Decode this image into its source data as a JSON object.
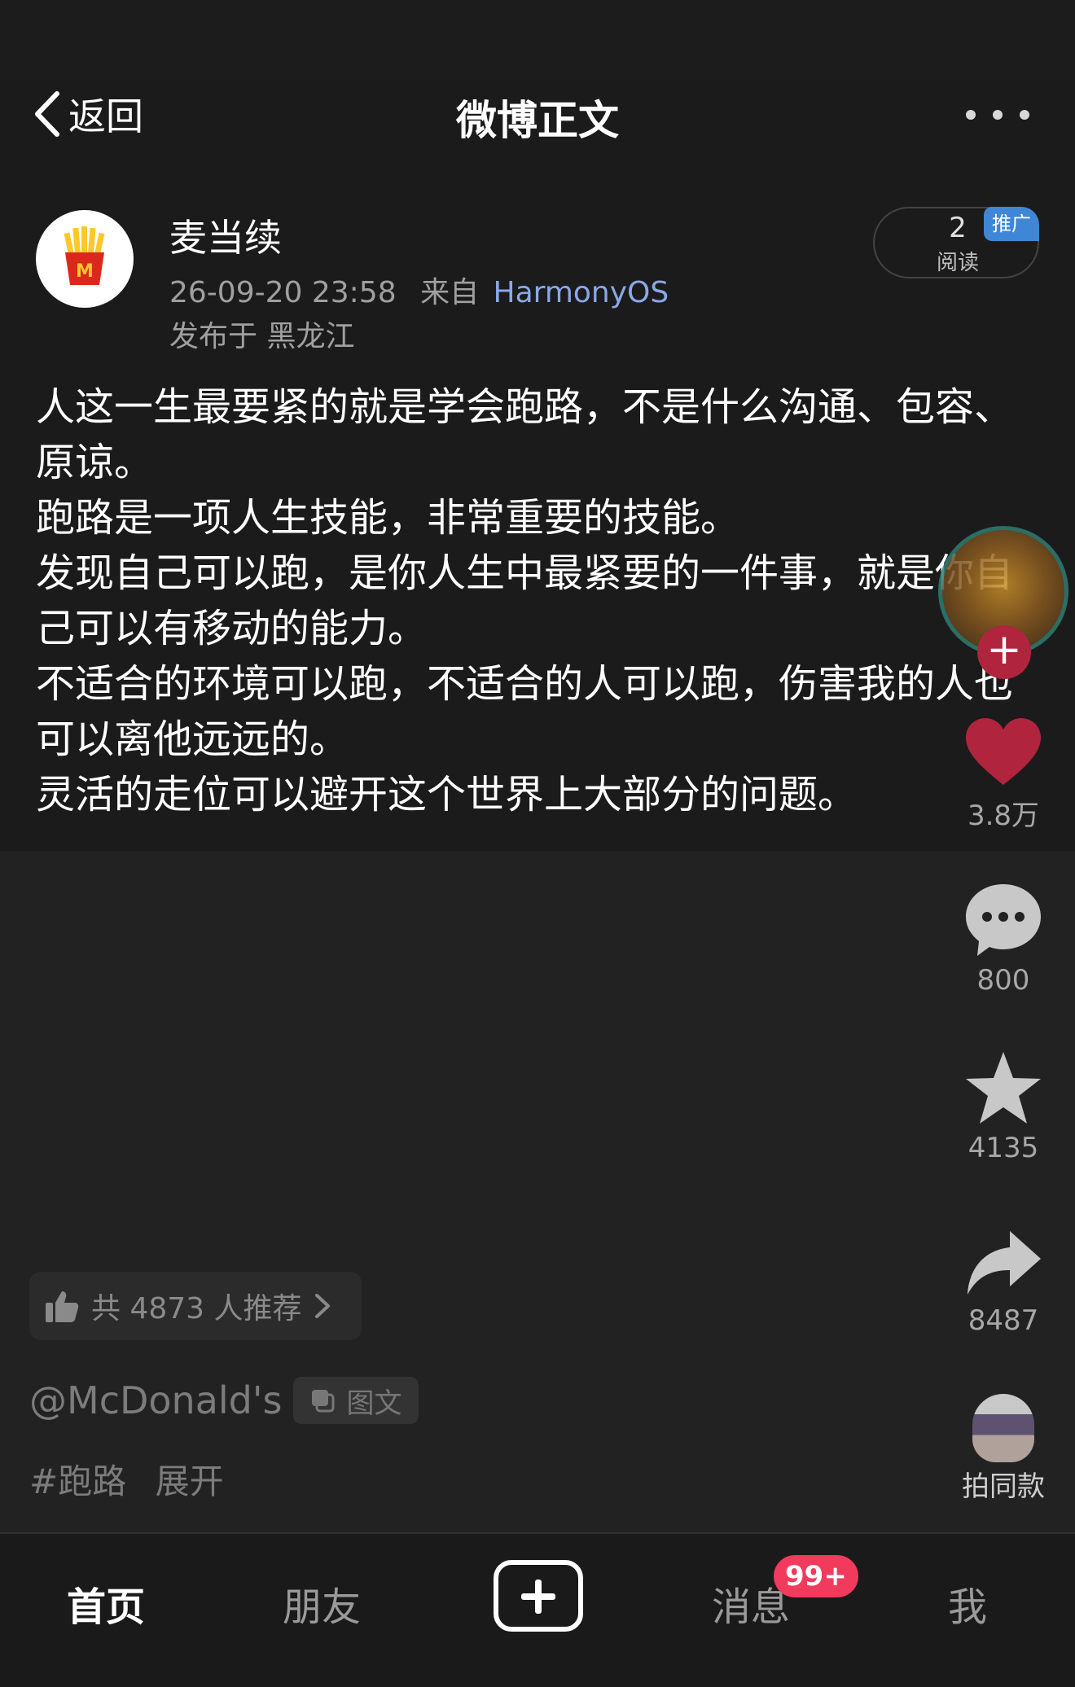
{
  "header": {
    "back_label": "返回",
    "title": "微博正文"
  },
  "author": {
    "name": "麦当续",
    "timestamp": "26-09-20 23:58",
    "from_prefix": "来自",
    "source": "HarmonyOS",
    "location": "发布于 黑龙江"
  },
  "reads": {
    "count": "2",
    "label": "阅读",
    "badge": "推广"
  },
  "post": {
    "paragraphs": [
      "人这一生最要紧的就是学会跑路，不是什么沟通、包容、原谅。",
      "跑路是一项人生技能，非常重要的技能。",
      "发现自己可以跑，是你人生中最紧要的一件事，就是你自己可以有移动的能力。",
      "不适合的环境可以跑，不适合的人可以跑，伤害我的人也可以离他远远的。",
      "灵活的走位可以避开这个世界上大部分的问题。"
    ]
  },
  "actions": {
    "likes": "3.8万",
    "comments": "800",
    "favorites": "4135",
    "shares": "8487",
    "same_style": "拍同款"
  },
  "recommend": {
    "text": "共 4873 人推荐"
  },
  "mention": {
    "handle": "@McDonald's",
    "type_label": "图文"
  },
  "tags": {
    "tag": "#跑路",
    "expand": "展开"
  },
  "tabbar": {
    "home": "首页",
    "friends": "朋友",
    "messages": "消息",
    "messages_badge": "99+",
    "me": "我"
  },
  "colors": {
    "background": "#222222",
    "source_link": "#8aa8e8",
    "promo_badge": "#3f86d6",
    "like_heart": "#b0253d",
    "message_badge": "#f23a5c",
    "mcdonalds_red": "#da291c",
    "mcdonalds_yellow": "#ffc72c"
  }
}
